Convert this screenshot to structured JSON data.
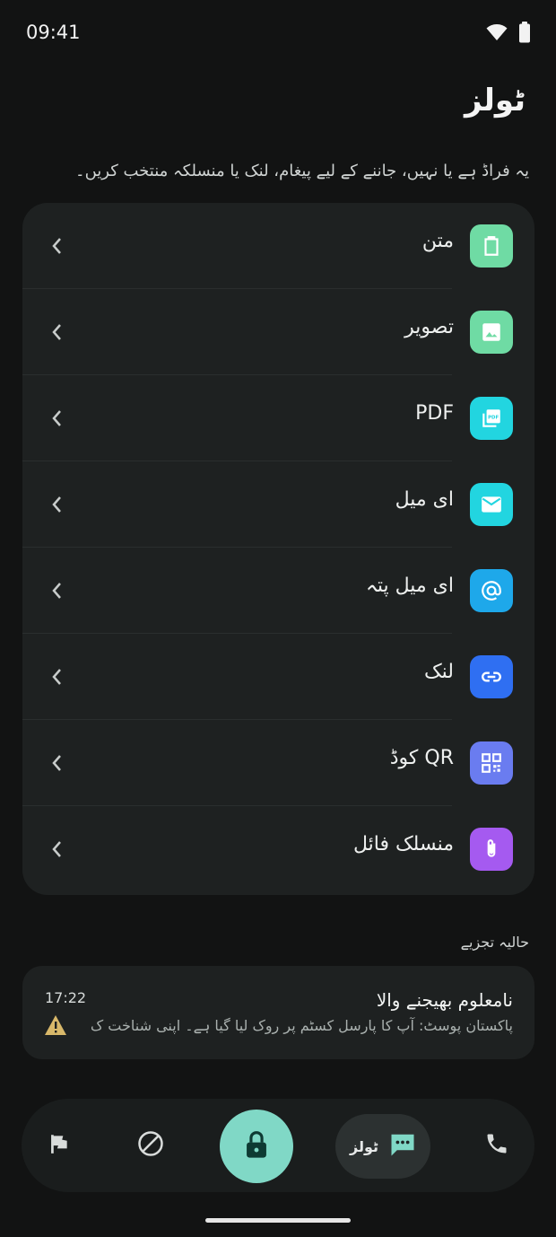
{
  "status": {
    "time": "09:41"
  },
  "header": {
    "title": "ٹولز",
    "subtitle": "یہ فراڈ ہے یا نہیں، جاننے کے لیے پیغام، لنک یا منسلکہ منتخب کریں۔"
  },
  "tools": [
    {
      "label": "متن",
      "icon": "clipboard-icon",
      "color": "#6fdba4"
    },
    {
      "label": "تصویر",
      "icon": "image-icon",
      "color": "#6fdba4"
    },
    {
      "label": "PDF",
      "icon": "pdf-icon",
      "color": "#22d5e0"
    },
    {
      "label": "ای میل",
      "icon": "mail-icon",
      "color": "#22d5e0"
    },
    {
      "label": "ای میل پتہ",
      "icon": "at-icon",
      "color": "#1ea8ea"
    },
    {
      "label": "لنک",
      "icon": "link-icon",
      "color": "#2f6ff2"
    },
    {
      "label": "QR کوڈ",
      "icon": "qr-icon",
      "color": "#6a7cf0"
    },
    {
      "label": "منسلک فائل",
      "icon": "paperclip-icon",
      "color": "#a55af0"
    }
  ],
  "recent": {
    "section_label": "حالیہ تجزیے",
    "items": [
      {
        "title": "نامعلوم بھیجنے والا",
        "preview": "پاکستان پوسٹ: آپ کا پارسل کسٹم پر روک لیا گیا ہے۔ اپنی شناخت ک...",
        "time": "17:22",
        "status_icon": "warning-icon",
        "status_color": "#d8b86a"
      }
    ]
  },
  "nav": {
    "tools_label": "ٹولز",
    "accent": "#80d8c6"
  }
}
